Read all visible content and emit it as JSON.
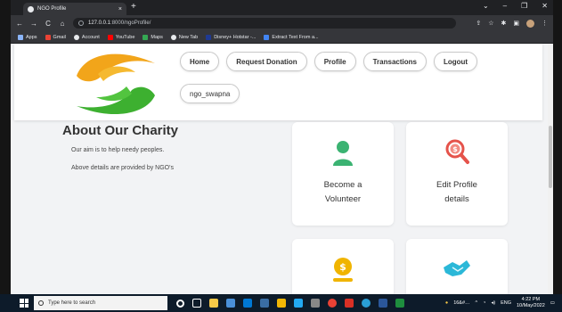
{
  "browser": {
    "tab_title": "NGO Profile",
    "tab_close": "×",
    "new_tab": "+",
    "window_controls": [
      "⌄",
      "–",
      "❐",
      "✕"
    ],
    "url_host": "127.0.0.1",
    "url_rest": ":8000/ngoProfile/",
    "nav_buttons": [
      "←",
      "→",
      "C",
      "⌂"
    ],
    "toolbar_icons": [
      "⇪",
      "☆",
      "✱",
      "▣"
    ],
    "bookmarks": [
      {
        "label": "Apps",
        "color": "#8ab4f8"
      },
      {
        "label": "Gmail",
        "color": "#ea4335"
      },
      {
        "label": "Account",
        "color": "#e8eaed"
      },
      {
        "label": "YouTube",
        "color": "#ff0000"
      },
      {
        "label": "Maps",
        "color": "#34a853"
      },
      {
        "label": "New Tab",
        "color": "#e8eaed"
      },
      {
        "label": "Disney+ Hotstar -...",
        "color": "#1f3a93"
      },
      {
        "label": "Extract Text From a...",
        "color": "#4285f4"
      }
    ]
  },
  "page": {
    "nav": [
      "Home",
      "Request Donation",
      "Profile",
      "Transactions",
      "Logout"
    ],
    "username": "ngo_swapna",
    "about_title": "About Our Charity",
    "about_line1": "Our aim is to help needy peoples.",
    "about_line2": "Above details are provided by NGO's",
    "cards": [
      {
        "label1": "Become a",
        "label2": "Volunteer",
        "icon": "person-icon",
        "color": "#3bb372"
      },
      {
        "label1": "Edit Profile",
        "label2": "details",
        "icon": "dollar-search-icon",
        "color": "#e5534b"
      },
      {
        "icon": "coin-hand-icon",
        "color": "#f0b400"
      },
      {
        "icon": "handshake-icon",
        "color": "#2bb8d8"
      }
    ],
    "colors": {
      "logo_orange": "#f2a51a",
      "logo_green": "#3db030"
    }
  },
  "taskbar": {
    "search_placeholder": "Type here to search",
    "weather": "16&#…",
    "language": "ENG",
    "time": "4:22 PM",
    "date": "10/May/2022"
  }
}
